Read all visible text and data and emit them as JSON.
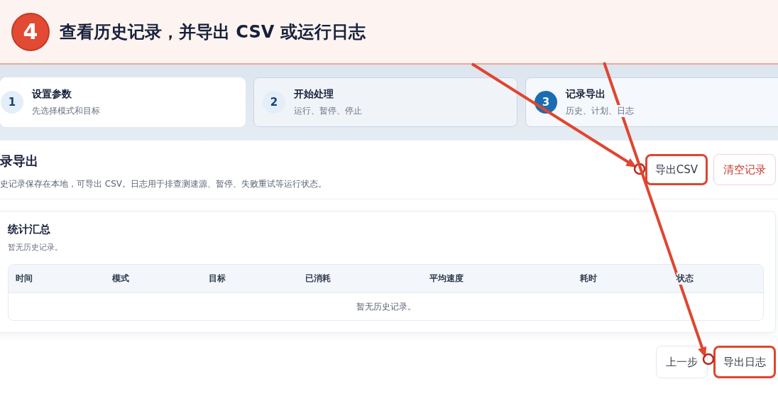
{
  "banner": {
    "badge": "4",
    "title": "查看历史记录，并导出 CSV 或运行日志"
  },
  "steps": [
    {
      "number": "1",
      "title": "设置参数",
      "subtitle": "先选择模式和目标",
      "completed": true,
      "selected": false
    },
    {
      "number": "2",
      "title": "开始处理",
      "subtitle": "运行、暂停、停止",
      "completed": false,
      "selected": false
    },
    {
      "number": "3",
      "title": "记录导出",
      "subtitle": "历史、计划、日志",
      "completed": false,
      "selected": true
    }
  ],
  "section": {
    "title": "录导出",
    "description": "史记录保存在本地，可导出 CSV。日志用于排查测速源、暂停、失败重试等运行状态。",
    "actions": [
      {
        "label": "导出CSV",
        "kind": "normal",
        "highlighted": true
      },
      {
        "label": "清空记录",
        "kind": "danger",
        "highlighted": false
      }
    ]
  },
  "summary": {
    "title": "统计汇总",
    "subtitle": "暂无历史记录。",
    "table": {
      "columns": [
        "时间",
        "模式",
        "目标",
        "已消耗",
        "平均速度",
        "耗时",
        "状态"
      ],
      "empty": "暂无历史记录。"
    }
  },
  "footer": [
    {
      "label": "上一步",
      "highlighted": false
    },
    {
      "label": "导出日志",
      "highlighted": true
    }
  ]
}
